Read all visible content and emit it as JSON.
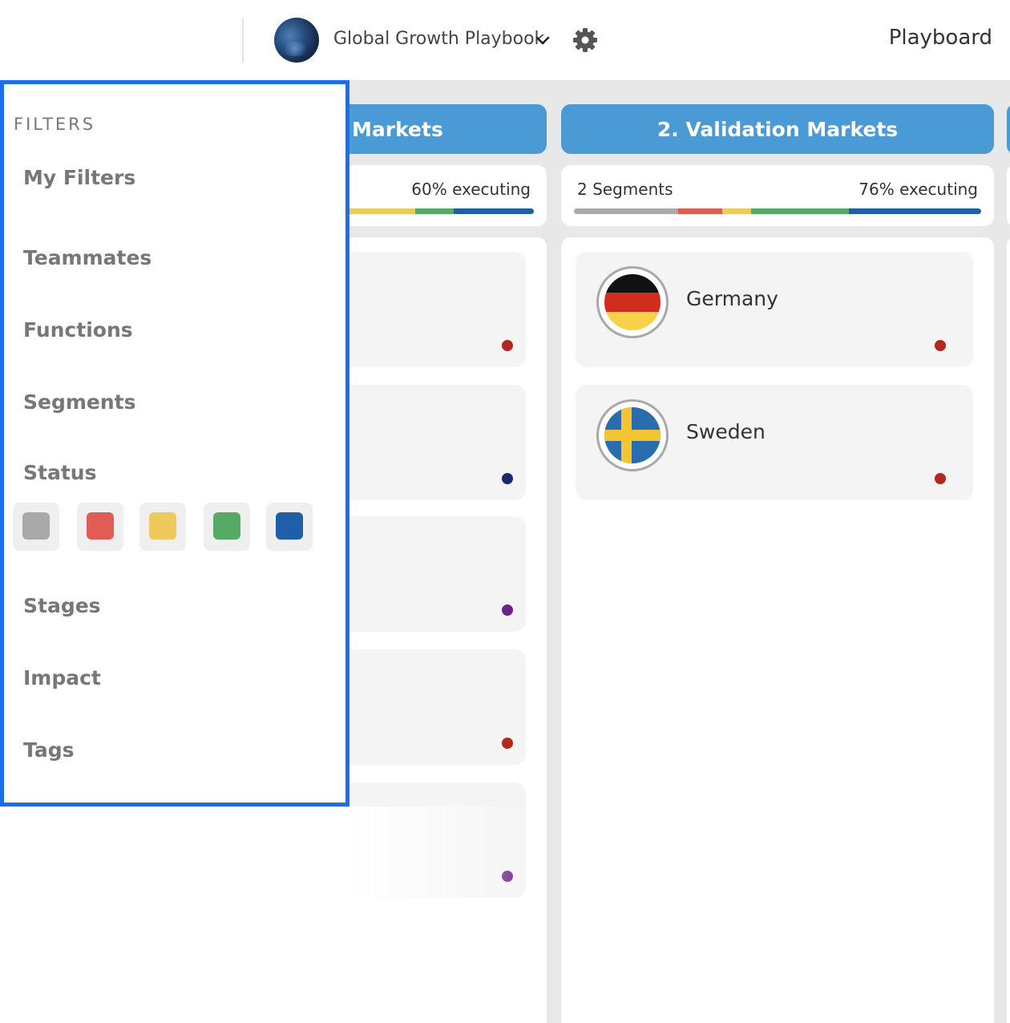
{
  "header": {
    "playbook_title": "Global Growth Playbook",
    "brand": "Playboard",
    "icons": [
      "playbook-avatar",
      "chevron-down-icon",
      "gear-icon"
    ]
  },
  "columns": [
    {
      "title": "Markets",
      "executing": "60% executing",
      "bar": [
        {
          "color": "#e05c55",
          "fraction": 0.05
        },
        {
          "color": "#eec95c",
          "fraction": 0.43
        },
        {
          "color": "#55ab66",
          "fraction": 0.17
        },
        {
          "color": "#1f5ea8",
          "fraction": 0.35
        }
      ],
      "cards": [
        {
          "dot": "#b0281e"
        },
        {
          "dot": "#1a2a6e"
        },
        {
          "dot": "#6a2386"
        },
        {
          "dot": "#b0281e"
        },
        {
          "dot": "#6a2386"
        }
      ]
    },
    {
      "title": "2. Validation Markets",
      "segments": "2 Segments",
      "executing": "76% executing",
      "bar": [
        {
          "color": "#aaaaaa",
          "fraction": 0.255
        },
        {
          "color": "#e05c55",
          "fraction": 0.11
        },
        {
          "color": "#eec95c",
          "fraction": 0.07
        },
        {
          "color": "#55ab66",
          "fraction": 0.24
        },
        {
          "color": "#1f5ea8",
          "fraction": 0.325
        }
      ],
      "cards": [
        {
          "name": "Germany",
          "flag": "germany-flag",
          "dot": "#b0281e"
        },
        {
          "name": "Sweden",
          "flag": "sweden-flag",
          "dot": "#b0281e"
        }
      ]
    }
  ],
  "filters": {
    "title": "FILTERS",
    "my_filters": "My Filters",
    "teammates": "Teammates",
    "functions": "Functions",
    "segments": "Segments",
    "status": "Status",
    "stages": "Stages",
    "impact": "Impact",
    "tags": "Tags",
    "status_colors": [
      "#a9a9a9",
      "#e05c55",
      "#eec95c",
      "#55ab66",
      "#1f5ea8"
    ],
    "accent": "#1a6ef0"
  }
}
